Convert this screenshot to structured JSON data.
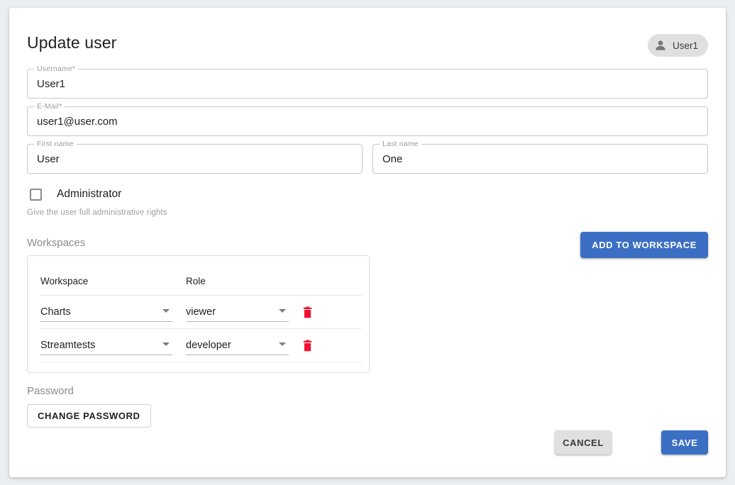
{
  "page": {
    "title": "Update user",
    "background_color": "#eceff1",
    "card_color": "#ffffff"
  },
  "user_chip": {
    "icon": "person-icon",
    "label": "User1"
  },
  "fields": {
    "username": {
      "label": "Username",
      "required_marker": "*",
      "value": "User1",
      "placeholder": "Username"
    },
    "email": {
      "label": "E-Mail",
      "required_marker": "*",
      "value": "user1@user.com",
      "placeholder": "E-Mail"
    },
    "first_name": {
      "label": "First name",
      "required_marker": "",
      "value": "User",
      "placeholder": "First name"
    },
    "last_name": {
      "label": "Last name",
      "required_marker": "",
      "value": "One",
      "placeholder": "Last name"
    }
  },
  "administrator": {
    "label": "Administrator",
    "checked": false,
    "hint": "Give the user full administrative rights"
  },
  "workspaces": {
    "section_label": "Workspaces",
    "add_button_label": "ADD TO WORKSPACE",
    "columns": [
      "Workspace",
      "Role"
    ],
    "rows": [
      {
        "workspace": "Charts",
        "role": "viewer",
        "delete_icon": "trash-icon"
      },
      {
        "workspace": "Streamtests",
        "role": "developer",
        "delete_icon": "trash-icon"
      }
    ]
  },
  "password": {
    "section_label": "Password",
    "change_button_label": "CHANGE PASSWORD"
  },
  "actions": {
    "cancel_label": "CANCEL",
    "save_label": "SAVE"
  },
  "colors": {
    "primary": "#3b6fc4",
    "delete": "#f5112f",
    "chip": "#e0e0e0",
    "muted_text": "#9e9e9e"
  }
}
